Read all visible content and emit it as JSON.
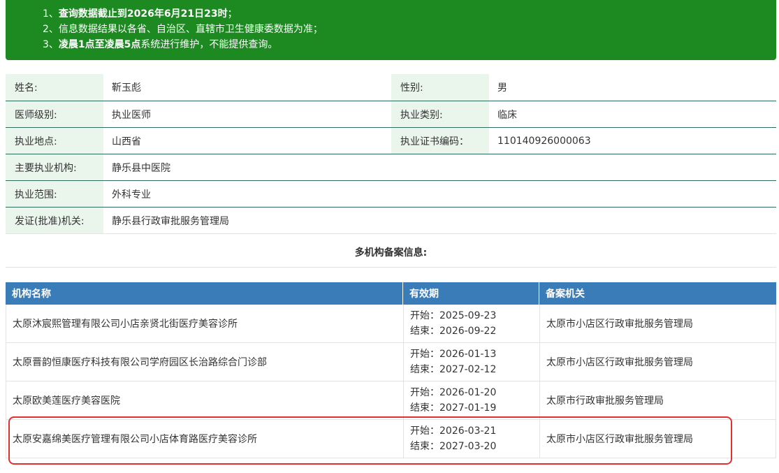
{
  "notice": {
    "lines": [
      {
        "prefix": "1、",
        "bold": "查询数据截止到2026年6月21日23时",
        "suffix": "；"
      },
      {
        "prefix": "2、",
        "bold": "",
        "suffix": "信息数据结果以各省、自治区、直辖市卫生健康委数据为准；"
      },
      {
        "prefix": "3、",
        "bold": "凌晨1点至凌晨5点",
        "suffix": "系统进行维护，不能提供查询。"
      }
    ]
  },
  "info": {
    "name_label": "姓名:",
    "name": "靳玉彪",
    "gender_label": "性别:",
    "gender": "男",
    "level_label": "医师级别:",
    "level": "执业医师",
    "category_label": "执业类别:",
    "category": "临床",
    "place_label": "执业地点:",
    "place": "山西省",
    "cert_label": "执业证书编码：",
    "cert": "110140926000063",
    "org_label": "主要执业机构:",
    "org": "静乐县中医院",
    "scope_label": "执业范围:",
    "scope": "外科专业",
    "issuer_label": "发证(批准)机关:",
    "issuer": "静乐县行政审批服务管理局"
  },
  "multi_title": "多机构备案信息:",
  "table": {
    "headers": [
      "机构名称",
      "有效期",
      "备案机关"
    ],
    "rows": [
      {
        "name": "太原沐宸熙管理有限公司小店亲贤北街医疗美容诊所",
        "start": "开始：2025-09-23",
        "end": "结束：2026-09-22",
        "authority": "太原市小店区行政审批服务管理局"
      },
      {
        "name": "太原晋韵恒康医疗科技有限公司学府园区长治路综合门诊部",
        "start": "开始：2026-01-13",
        "end": "结束：2027-02-12",
        "authority": "太原市小店区行政审批服务管理局"
      },
      {
        "name": "太原欧美莲医疗美容医院",
        "start": "开始：2026-01-20",
        "end": "结束：2027-01-19",
        "authority": "太原市行政审批服务管理局"
      },
      {
        "name": "太原安嘉绵美医疗管理有限公司小店体育路医疗美容诊所",
        "start": "开始：2026-03-21",
        "end": "结束：2027-03-20",
        "authority": "太原市小店区行政审批服务管理局"
      }
    ]
  },
  "colors": {
    "notice_bg": "#1d8a21",
    "header_bg": "#3a7cb8",
    "label_bg": "#eaf5ec",
    "highlight": "#e0312f"
  }
}
